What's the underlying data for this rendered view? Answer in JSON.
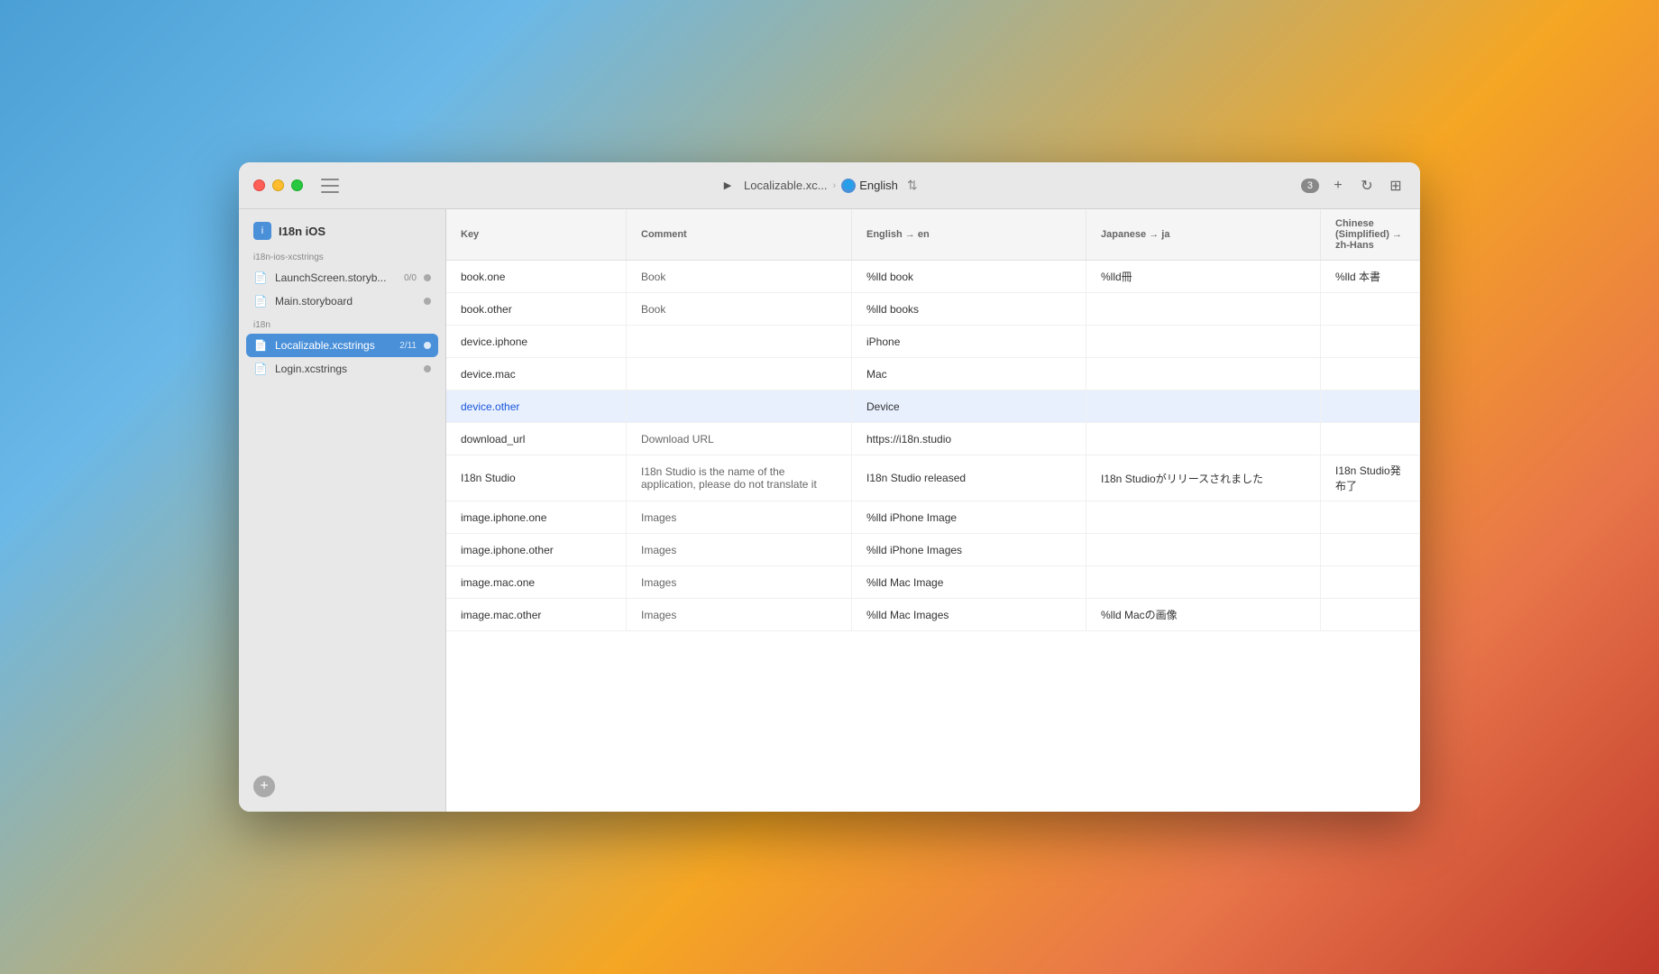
{
  "window": {
    "title": "I18n iOS"
  },
  "titlebar": {
    "project_name": "Localizable.xc...",
    "language": "English",
    "badge_count": "3",
    "add_label": "+",
    "refresh_label": "↻"
  },
  "sidebar": {
    "project_label": "I18n iOS",
    "sections": [
      {
        "header": "i18n-ios-xcstrings",
        "items": [
          {
            "name": "LaunchScreen.storyb...",
            "badge": "0/0",
            "icon": "📄"
          },
          {
            "name": "Main.storyboard",
            "badge": "",
            "icon": "📄"
          }
        ]
      },
      {
        "header": "i18n",
        "items": [
          {
            "name": "Localizable.xcstrings",
            "badge": "2/11",
            "icon": "📄",
            "active": true
          },
          {
            "name": "Login.xcstrings",
            "badge": "",
            "icon": "📄"
          }
        ]
      }
    ],
    "add_button_label": "+"
  },
  "table": {
    "headers": [
      {
        "id": "key",
        "label": "Key"
      },
      {
        "id": "comment",
        "label": "Comment"
      },
      {
        "id": "english",
        "label": "English → en"
      },
      {
        "id": "japanese",
        "label": "Japanese → ja"
      },
      {
        "id": "chinese",
        "label": "Chinese (Simplified) → zh-Hans"
      }
    ],
    "rows": [
      {
        "key": "book.one",
        "comment": "Book",
        "english": "%lld book",
        "japanese": "%lld冊",
        "chinese": "%lld 本書",
        "highlighted": false
      },
      {
        "key": "book.other",
        "comment": "Book",
        "english": "%lld books",
        "japanese": "",
        "chinese": "",
        "highlighted": false
      },
      {
        "key": "device.iphone",
        "comment": "",
        "english": "iPhone",
        "japanese": "",
        "chinese": "",
        "highlighted": false
      },
      {
        "key": "device.mac",
        "comment": "",
        "english": "Mac",
        "japanese": "",
        "chinese": "",
        "highlighted": false
      },
      {
        "key": "device.other",
        "comment": "",
        "english": "Device",
        "japanese": "",
        "chinese": "",
        "highlighted": true
      },
      {
        "key": "download_url",
        "comment": "Download URL",
        "english": "https://i18n.studio",
        "japanese": "",
        "chinese": "",
        "highlighted": false
      },
      {
        "key": "I18n Studio",
        "comment": "I18n Studio is the name of the application, please do not translate it",
        "english": "I18n Studio released",
        "japanese": "I18n Studioがリリースされました",
        "chinese": "I18n Studio発布了",
        "highlighted": false,
        "multiline_comment": true
      },
      {
        "key": "image.iphone.one",
        "comment": "Images",
        "english": "%lld iPhone Image",
        "japanese": "",
        "chinese": "",
        "highlighted": false
      },
      {
        "key": "image.iphone.other",
        "comment": "Images",
        "english": "%lld iPhone Images",
        "japanese": "",
        "chinese": "",
        "highlighted": false
      },
      {
        "key": "image.mac.one",
        "comment": "Images",
        "english": "%lld Mac Image",
        "japanese": "",
        "chinese": "",
        "highlighted": false
      },
      {
        "key": "image.mac.other",
        "comment": "Images",
        "english": "%lld Mac Images",
        "japanese": "%lld Macの画像",
        "chinese": "",
        "highlighted": false
      }
    ]
  }
}
